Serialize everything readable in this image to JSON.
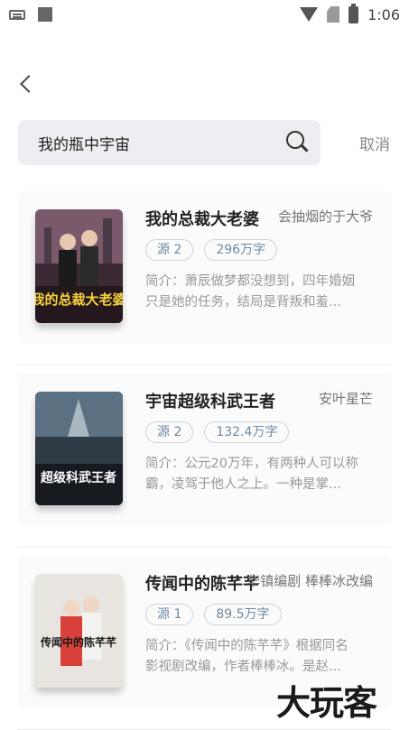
{
  "status_bar": {
    "time": "1:06"
  },
  "search": {
    "value": "我的瓶中宇宙",
    "cancel_label": "取消"
  },
  "books": [
    {
      "title": "我的总裁大老婆",
      "author": "会抽烟的于大爷",
      "source": "源 2",
      "word_count": "296万字",
      "description": "简介：萧辰做梦都没想到，四年婚姻只是她的任务，结局是背叛和羞...",
      "cover_text": "我的总裁大老婆",
      "cover_color": "#c0392b"
    },
    {
      "title": "宇宙超级科武王者",
      "author": "安叶星芒",
      "source": "源 2",
      "word_count": "132.4万字",
      "description": "简介：公元20万年，有两种人可以称霸，凌驾于他人之上。一种是掌...",
      "cover_text": "超级科武王者",
      "cover_color": "#2c3e50"
    },
    {
      "title": "传闻中的陈芊芊",
      "author": "华镇编剧 棒棒冰改编",
      "source": "源 1",
      "word_count": "89.5万字",
      "description": "简介：《传闻中的陈芊芊》根据同名影视剧改编，作者棒棒冰。是赵...",
      "cover_text": "传闻中的陈芊芊",
      "cover_color": "#e8e0da"
    }
  ],
  "watermark": "大玩客"
}
